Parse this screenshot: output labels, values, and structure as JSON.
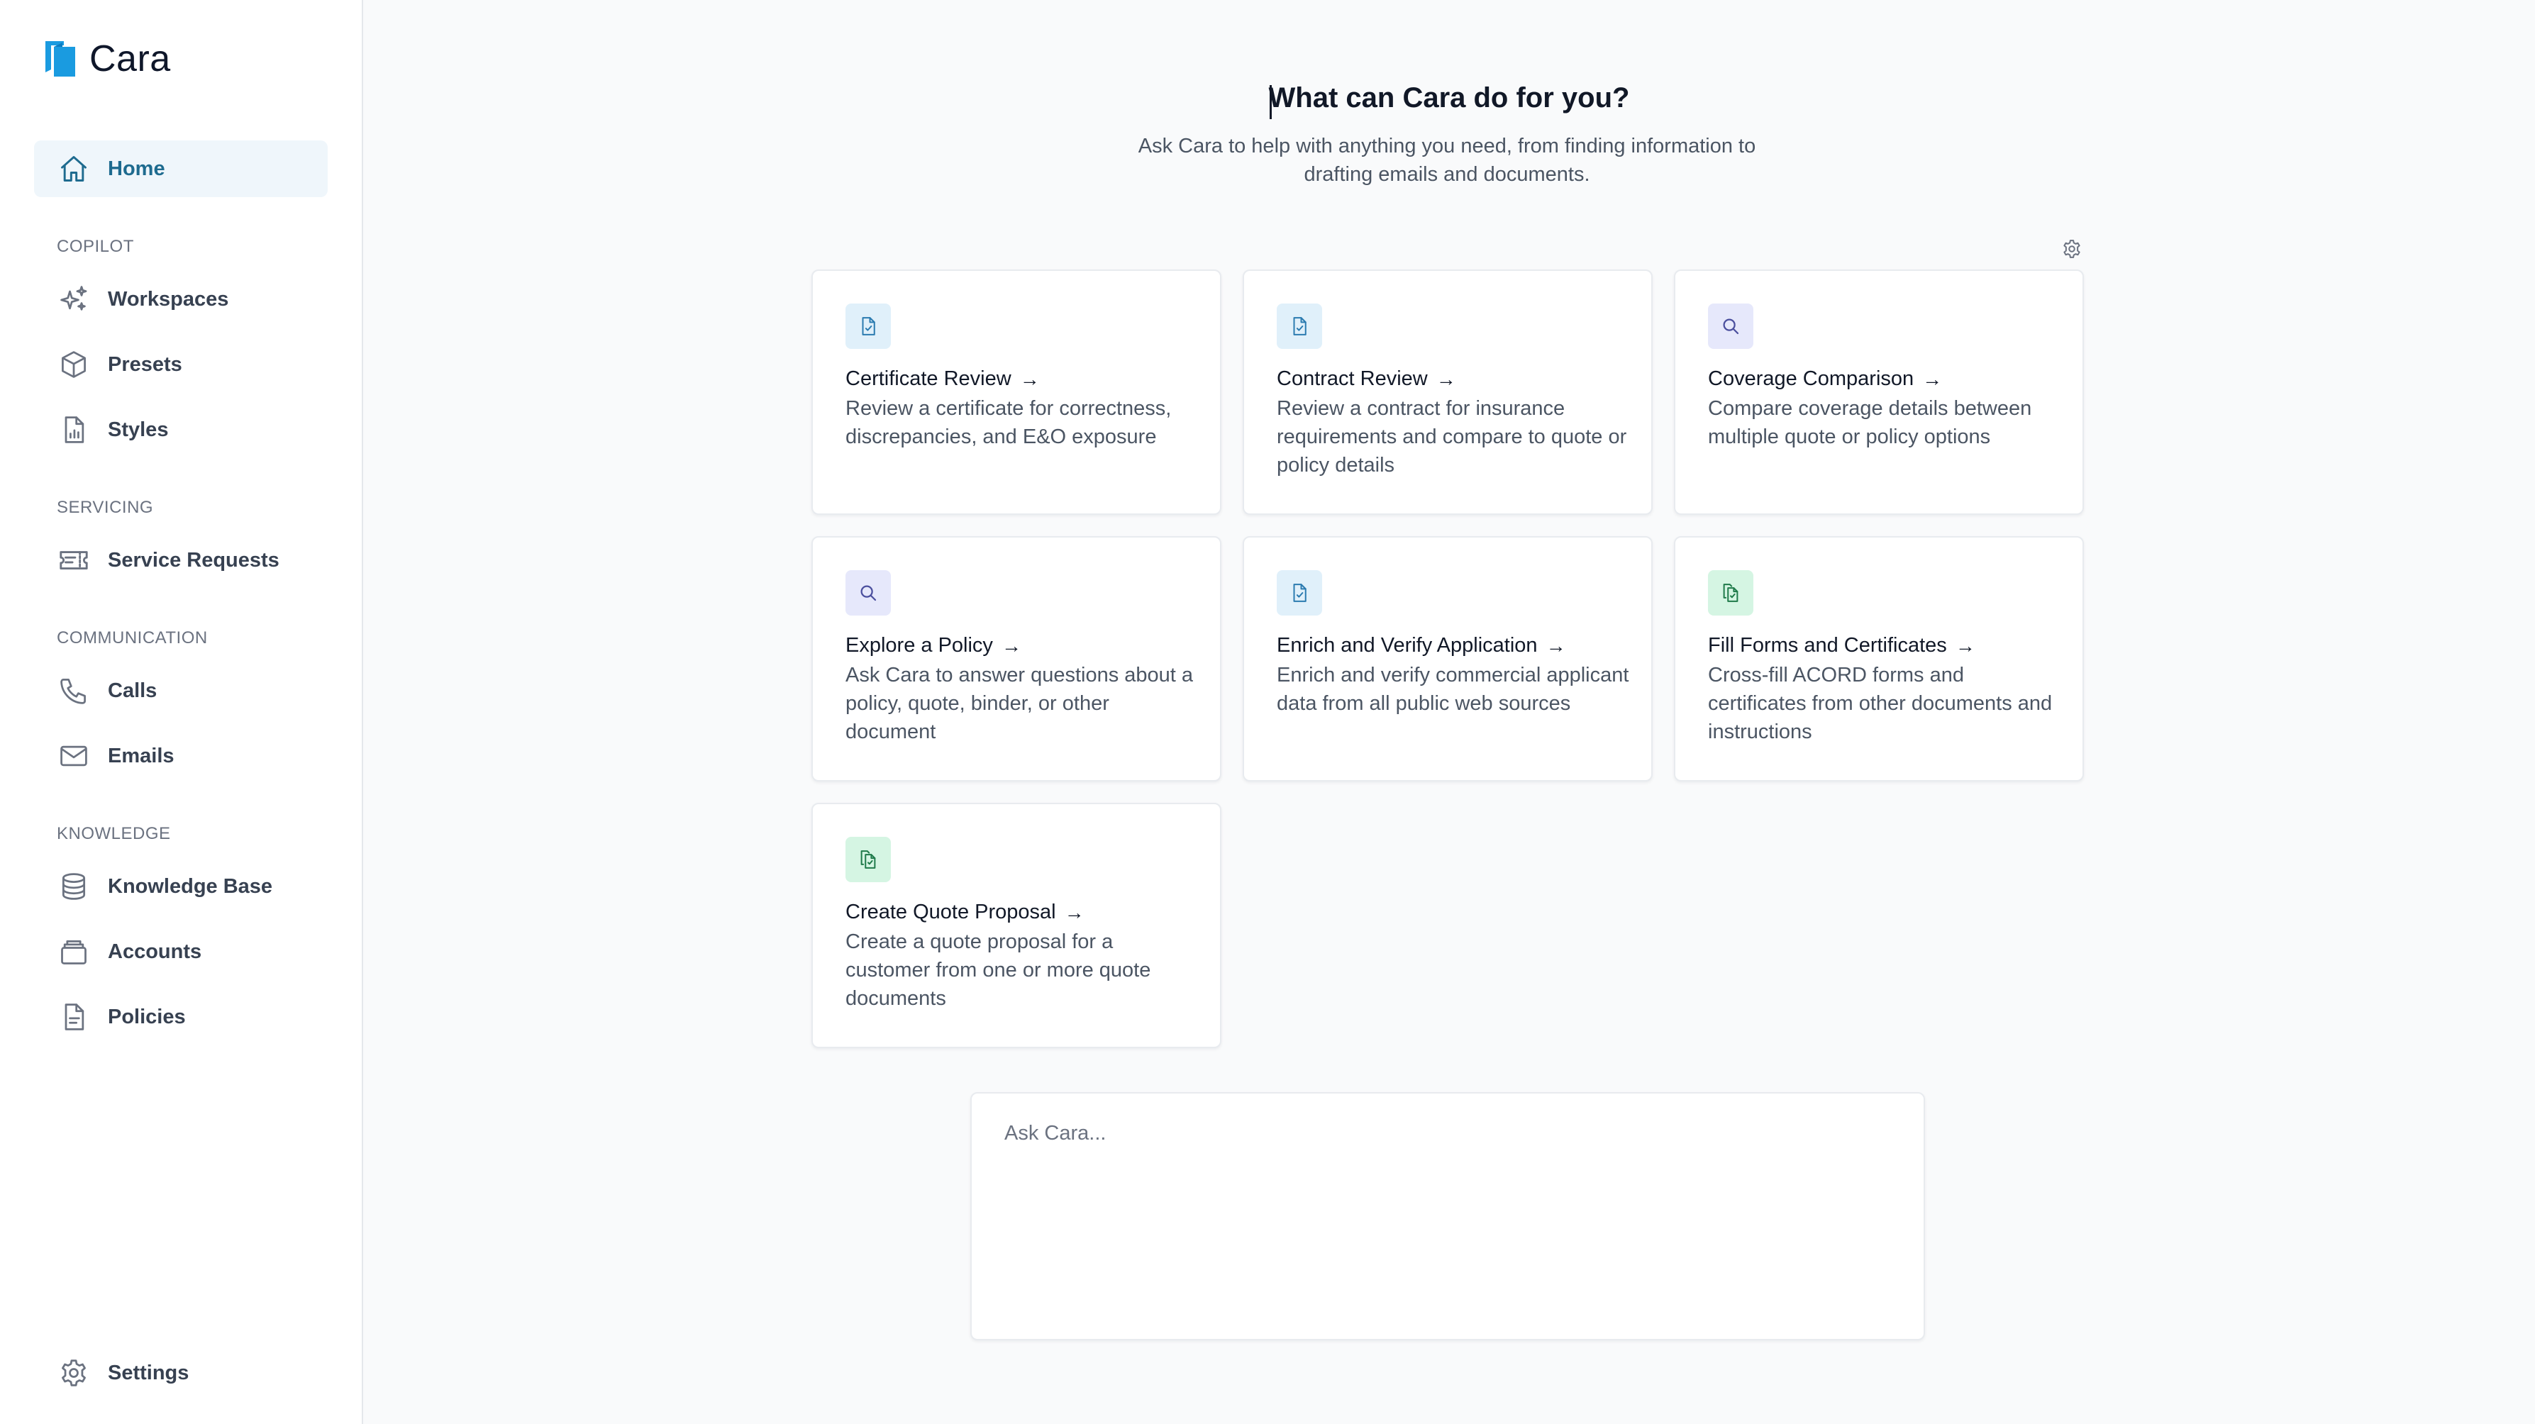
{
  "brand": {
    "name": "Cara"
  },
  "nav": {
    "home": "Home",
    "sections": {
      "copilot": "COPILOT",
      "servicing": "SERVICING",
      "communication": "COMMUNICATION",
      "knowledge": "KNOWLEDGE"
    },
    "workspaces": "Workspaces",
    "presets": "Presets",
    "styles": "Styles",
    "service_requests": "Service Requests",
    "calls": "Calls",
    "emails": "Emails",
    "knowledge_base": "Knowledge Base",
    "accounts": "Accounts",
    "policies": "Policies",
    "settings": "Settings"
  },
  "main": {
    "title": "What can Cara do for you?",
    "subtitle": "Ask Cara to help with anything you need, from finding information to drafting emails and documents.",
    "cards": [
      {
        "title": "Certificate Review",
        "desc": "Review a certificate for correctness, discrepancies, and E&O exposure",
        "icon": "document-check-icon"
      },
      {
        "title": "Contract Review",
        "desc": "Review a contract for insurance requirements and compare to quote or policy details",
        "icon": "document-check-icon"
      },
      {
        "title": "Coverage Comparison",
        "desc": "Compare coverage details between multiple quote or policy options",
        "icon": "search-icon"
      },
      {
        "title": "Explore a Policy",
        "desc": "Ask Cara to answer questions about a policy, quote, binder, or other document",
        "icon": "search-icon"
      },
      {
        "title": "Enrich and Verify Application",
        "desc": "Enrich and verify commercial applicant data from all public web sources",
        "icon": "document-check-icon"
      },
      {
        "title": "Fill Forms and Certificates",
        "desc": "Cross-fill ACORD forms and certificates from other documents and instructions",
        "icon": "documents-copy-icon"
      },
      {
        "title": "Create Quote Proposal",
        "desc": "Create a quote proposal for a customer from one or more quote documents",
        "icon": "documents-copy-icon"
      }
    ],
    "arrow": "→",
    "ask_placeholder": "Ask Cara..."
  },
  "colors": {
    "accent": "#1e6b8f",
    "active_bg": "#eff6fb",
    "icon_blue_bg": "#e0f0fa",
    "icon_purple_bg": "#e6e8fb",
    "icon_green_bg": "#d5f5e3",
    "logo_blue": "#1a9be0"
  }
}
